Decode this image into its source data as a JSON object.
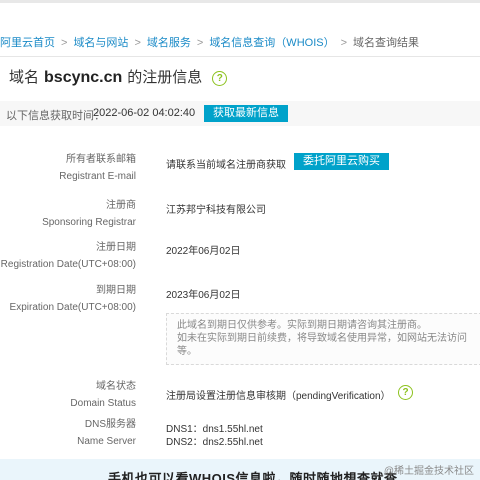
{
  "breadcrumb": [
    {
      "label": "阿里云首页"
    },
    {
      "label": "域名与网站"
    },
    {
      "label": "域名服务"
    },
    {
      "label": "域名信息查询（WHOIS）"
    },
    {
      "label": "域名查询结果"
    }
  ],
  "header": {
    "prefix": "域名",
    "domain": "bscync.cn",
    "suffix": "的注册信息",
    "help_icon": "question-circle-icon"
  },
  "fetch": {
    "label": "以下信息获取时间：",
    "time": "2022-06-02 04:02:40",
    "button": "获取最新信息"
  },
  "fields": {
    "registrant_email": {
      "label_cn": "所有者联系邮箱",
      "label_en": "Registrant E-mail",
      "value": "请联系当前域名注册商获取",
      "button": "委托阿里云购买"
    },
    "registrar": {
      "label_cn": "注册商",
      "label_en": "Sponsoring Registrar",
      "value": "江苏邦宁科技有限公司"
    },
    "registration_date": {
      "label_cn": "注册日期",
      "label_en": "Registration Date(UTC+08:00)",
      "value": "2022年06月02日"
    },
    "expiration_date": {
      "label_cn": "到期日期",
      "label_en": "Expiration Date(UTC+08:00)",
      "value": "2023年06月02日",
      "note_line1": "此域名到期日仅供参考。实际到期日期请咨询其注册商。",
      "note_line2": "如未在实际到期日前续费，将导致域名使用异常，如网站无法访问等。"
    },
    "domain_status": {
      "label_cn": "域名状态",
      "label_en": "Domain Status",
      "value": "注册局设置注册信息审核期（pendingVerification）"
    },
    "dns": {
      "label_cn": "DNS服务器",
      "label_en": "Name Server",
      "dns1": "DNS1：dns1.55hl.net",
      "dns2": "DNS2：dns2.55hl.net"
    }
  },
  "banner": {
    "text": "手机也可以看WHOIS信息啦，随时随地想查就查"
  },
  "watermark": "@稀土掘金技术社区",
  "colors": {
    "accent": "#00a2ca",
    "link": "#1a8ac7",
    "help": "#8dc21f"
  }
}
